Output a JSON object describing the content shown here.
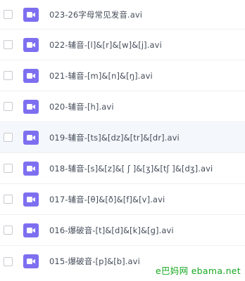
{
  "files": [
    {
      "name": "023-26字母常见发音.avi",
      "icon": "video-file-icon"
    },
    {
      "name": "022-辅音-[l]&[r]&[w]&[j].avi",
      "icon": "video-file-icon"
    },
    {
      "name": "021-辅音-[m]&[n]&[ŋ].avi",
      "icon": "video-file-icon"
    },
    {
      "name": "020-辅音-[h].avi",
      "icon": "video-file-icon"
    },
    {
      "name": "019-辅音-[ts]&[dz]&[tr]&[dr].avi",
      "icon": "video-file-icon"
    },
    {
      "name": "018-辅音-[s]&[z]&[ ʃ ]&[ʒ]&[tʃ ]&[dʒ].avi",
      "icon": "video-file-icon"
    },
    {
      "name": "017-辅音-[θ]&[ð]&[f]&[v].avi",
      "icon": "video-file-icon"
    },
    {
      "name": "016-爆破音-[t]&[d]&[k]&[g].avi",
      "icon": "video-file-icon"
    },
    {
      "name": "015-爆破音-[p]&[b].avi",
      "icon": "video-file-icon"
    }
  ],
  "hovered_row": 4,
  "watermark": "ebama.net",
  "watermark_prefix": "e巴妈网 ",
  "colors": {
    "icon_bg": "#7d6ff0",
    "row_hover_bg": "#f4f7fb",
    "text": "#454d5a",
    "watermark": "#16a81f"
  }
}
